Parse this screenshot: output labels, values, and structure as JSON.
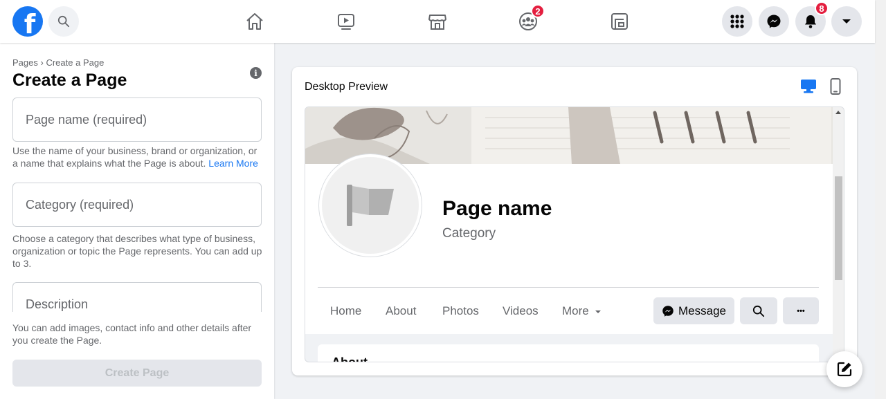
{
  "topnav": {
    "logo_letter": "f",
    "watch_badge": "",
    "groups_badge": "2",
    "notifications_badge": "8"
  },
  "sidebar": {
    "breadcrumb_pages": "Pages",
    "breadcrumb_sep": "›",
    "breadcrumb_current": "Create a Page",
    "title": "Create a Page",
    "info_glyph": "i",
    "page_name_placeholder": "Page name (required)",
    "page_name_help": "Use the name of your business, brand or organization, or a name that explains what the Page is about.",
    "learn_more": "Learn More",
    "category_placeholder": "Category (required)",
    "category_help": "Choose a category that describes what type of business, organization or topic the Page represents. You can add up to 3.",
    "description_placeholder": "Description",
    "footer_note": "You can add images, contact info and other details after you create the Page.",
    "create_button": "Create Page"
  },
  "preview": {
    "title": "Desktop Preview",
    "page_name": "Page name",
    "category": "Category",
    "tabs": [
      "Home",
      "About",
      "Photos",
      "Videos",
      "More"
    ],
    "message_button": "Message",
    "more_dots": "•••",
    "about_heading": "About"
  },
  "colors": {
    "brand": "#1877f2",
    "badge": "#e41e3f",
    "muted_text": "#65676b"
  }
}
